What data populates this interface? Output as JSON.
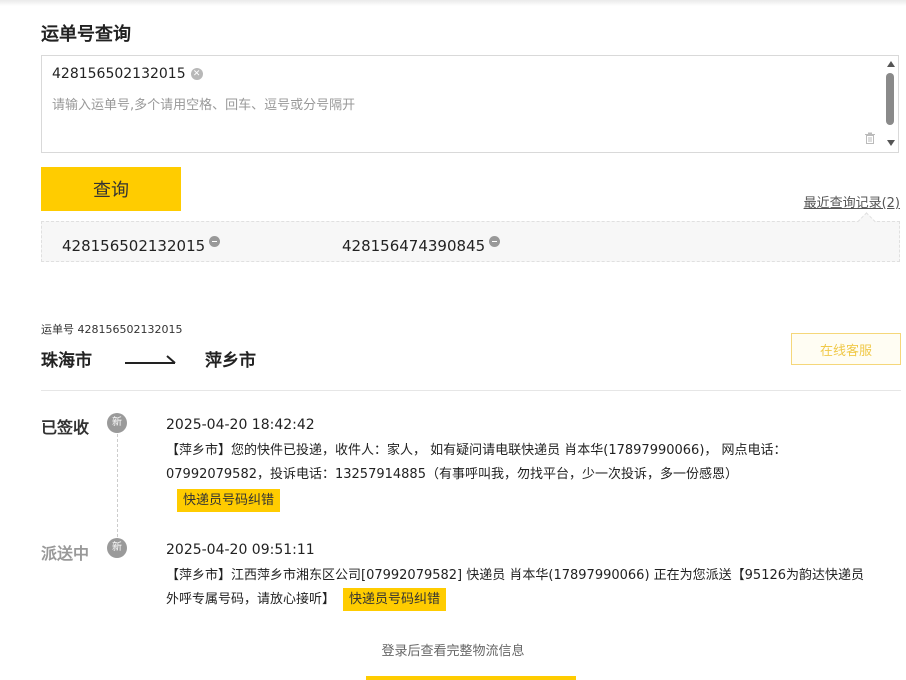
{
  "page_title": "运单号查询",
  "query": {
    "tag_value": "428156502132015",
    "placeholder": "请输入运单号,多个请用空格、回车、逗号或分号隔开"
  },
  "search_button_label": "查询",
  "recent_link": "最近查询记录(2)",
  "history": [
    "428156502132015",
    "428156474390845"
  ],
  "result": {
    "tracking_label": "运单号 428156502132015",
    "origin": "珠海市",
    "destination": "萍乡市",
    "service_button": "在线客服"
  },
  "events": [
    {
      "status": "已签收",
      "badge": "新",
      "time": "2025-04-20 18:42:42",
      "desc": "【萍乡市】您的快件已投递，收件人：家人， 如有疑问请电联快递员 肖本华(17897990066)， 网点电话：07992079582，投诉电话：13257914885（有事呼叫我，勿找平台，少一次投诉，多一份感恩）",
      "fix_label": "快递员号码纠错",
      "status_color": "#333333"
    },
    {
      "status": "派送中",
      "badge": "新",
      "time": "2025-04-20 09:51:11",
      "desc": "【萍乡市】江西萍乡市湘东区公司[07992079582] 快递员 肖本华(17897990066) 正在为您派送【95126为韵达快递员外呼专属号码，请放心接听】",
      "fix_label": "快递员号码纠错",
      "status_color": "#999999"
    }
  ],
  "login_hint": "登录后查看完整物流信息",
  "colors": {
    "accent": "#ffcc00"
  }
}
